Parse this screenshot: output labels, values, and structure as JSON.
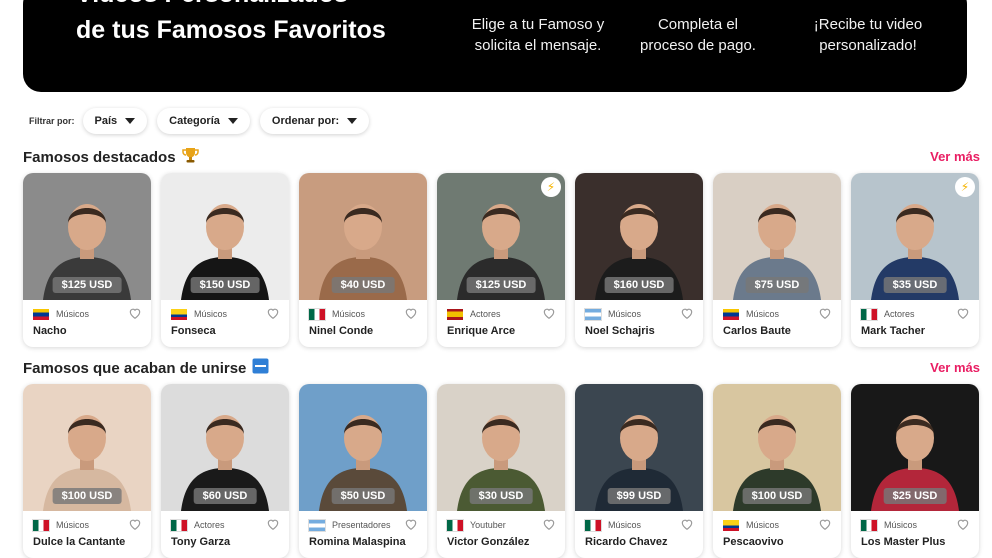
{
  "hero": {
    "title_line1": "Videos Personalizados",
    "title_line2": "de tus Famosos Favoritos",
    "steps": [
      {
        "line1": "Elige a tu Famoso y",
        "line2": "solicita el mensaje."
      },
      {
        "line1": "Completa el",
        "line2": "proceso de pago."
      },
      {
        "line1": "¡Recibe tu video",
        "line2": "personalizado!"
      }
    ]
  },
  "filters": {
    "label": "Filtrar por:",
    "options": [
      "País",
      "Categoría",
      "Ordenar por:"
    ]
  },
  "featured": {
    "title": "Famosos destacados",
    "icon": "trophy-icon",
    "see_more": "Ver más",
    "cards": [
      {
        "name": "Nacho",
        "category": "Músicos",
        "price": "$125 USD",
        "flag": "ve",
        "fast": false
      },
      {
        "name": "Fonseca",
        "category": "Músicos",
        "price": "$150 USD",
        "flag": "co",
        "fast": false
      },
      {
        "name": "Ninel Conde",
        "category": "Músicos",
        "price": "$40 USD",
        "flag": "mx",
        "fast": false
      },
      {
        "name": "Enrique Arce",
        "category": "Actores",
        "price": "$125 USD",
        "flag": "es",
        "fast": true
      },
      {
        "name": "Noel Schajris",
        "category": "Músicos",
        "price": "$160 USD",
        "flag": "ar",
        "fast": false
      },
      {
        "name": "Carlos Baute",
        "category": "Músicos",
        "price": "$75 USD",
        "flag": "ve",
        "fast": false
      },
      {
        "name": "Mark Tacher",
        "category": "Actores",
        "price": "$35 USD",
        "flag": "mx",
        "fast": true
      }
    ]
  },
  "new": {
    "title": "Famosos que acaban de unirse",
    "icon": "new-badge-icon",
    "see_more": "Ver más",
    "cards": [
      {
        "name": "Dulce la Cantante",
        "category": "Músicos",
        "price": "$100 USD",
        "flag": "mx",
        "fast": false
      },
      {
        "name": "Tony Garza",
        "category": "Actores",
        "price": "$60 USD",
        "flag": "mx",
        "fast": false
      },
      {
        "name": "Romina Malaspina",
        "category": "Presentadores",
        "price": "$50 USD",
        "flag": "ar",
        "fast": false
      },
      {
        "name": "Victor González",
        "category": "Youtuber",
        "price": "$30 USD",
        "flag": "mx",
        "fast": false
      },
      {
        "name": "Ricardo Chavez",
        "category": "Músicos",
        "price": "$99 USD",
        "flag": "mx",
        "fast": false
      },
      {
        "name": "Pescaovivo",
        "category": "Músicos",
        "price": "$100 USD",
        "flag": "co",
        "fast": false
      },
      {
        "name": "Los Master Plus",
        "category": "Músicos",
        "price": "$25 USD",
        "flag": "mx",
        "fast": false
      }
    ]
  },
  "colors": {
    "accent": "#e91e63",
    "hero_bg": "#000000"
  }
}
